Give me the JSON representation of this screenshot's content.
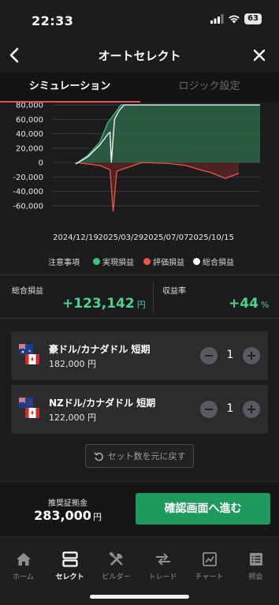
{
  "status_bar": {
    "time": "22:33",
    "battery": "63"
  },
  "nav": {
    "title": "オートセレクト"
  },
  "tabs": [
    {
      "label": "シミュレーション",
      "active": true
    },
    {
      "label": "ロジック設定",
      "active": false
    }
  ],
  "chart_data": {
    "type": "line",
    "yticks": [
      "80,000",
      "60,000",
      "40,000",
      "20,000",
      "0",
      "-20,000",
      "-40,000",
      "-60,000"
    ],
    "ylim": [
      -70000,
      80000
    ],
    "xticks": [
      "2024/12/19",
      "2025/03/29",
      "2025/07/07",
      "2025/10/15"
    ],
    "series": [
      {
        "name": "実現損益",
        "color": "#3ec27a",
        "points": [
          [
            "2024/12/19",
            -2000
          ],
          [
            "2025/01/15",
            10000
          ],
          [
            "2025/02/10",
            28000
          ],
          [
            "2025/02/28",
            55000
          ],
          [
            "2025/03/20",
            72000
          ],
          [
            "2025/03/29",
            80000
          ],
          [
            "2025/04/10",
            80000
          ]
        ]
      },
      {
        "name": "評価損益",
        "color": "#e8564a",
        "points": [
          [
            "2024/12/19",
            0
          ],
          [
            "2025/01/15",
            -2000
          ],
          [
            "2025/02/10",
            -4000
          ],
          [
            "2025/03/05",
            -10000
          ],
          [
            "2025/03/12",
            -68000
          ],
          [
            "2025/03/20",
            -12000
          ],
          [
            "2025/05/15",
            0
          ],
          [
            "2025/07/07",
            -1000
          ],
          [
            "2025/08/20",
            -4000
          ],
          [
            "2025/09/20",
            -10000
          ],
          [
            "2025/10/15",
            -14000
          ],
          [
            "2025/11/15",
            -22000
          ],
          [
            "2025/12/15",
            -15000
          ]
        ]
      },
      {
        "name": "総合損益",
        "color": "#ffffff",
        "points": [
          [
            "2024/12/19",
            -2000
          ],
          [
            "2025/01/15",
            8000
          ],
          [
            "2025/02/10",
            24000
          ],
          [
            "2025/03/01",
            40000
          ],
          [
            "2025/03/05",
            42000
          ],
          [
            "2025/03/08",
            0
          ],
          [
            "2025/03/15",
            60000
          ],
          [
            "2025/03/25",
            72000
          ],
          [
            "2025/04/05",
            80000
          ]
        ]
      }
    ]
  },
  "legend": {
    "notice": "注意事項",
    "items": [
      {
        "label": "実現損益",
        "color": "#3ec27a"
      },
      {
        "label": "評価損益",
        "color": "#e8564a"
      },
      {
        "label": "総合損益",
        "color": "#ffffff"
      }
    ]
  },
  "summary": {
    "total_label": "総合損益",
    "total_value": "+123,142",
    "total_unit": "円",
    "rate_label": "収益率",
    "rate_value": "+44",
    "rate_unit": "%"
  },
  "pairs": [
    {
      "name": "豪ドル/カナダドル 短期",
      "price": "182,000 円",
      "qty": "1",
      "flag": "AUD"
    },
    {
      "name": "NZドル/カナダドル 短期",
      "price": "122,000 円",
      "qty": "1",
      "flag": "NZD"
    }
  ],
  "reset_label": "セット数を元に戻す",
  "bottom": {
    "margin_label": "推奨証拠金",
    "margin_value": "283,000",
    "margin_unit": "円",
    "confirm_label": "確認画面へ進む"
  },
  "tabbar": [
    {
      "label": "ホーム",
      "icon": "home-icon",
      "active": false
    },
    {
      "label": "セレクト",
      "icon": "select-icon",
      "active": true
    },
    {
      "label": "ビルダー",
      "icon": "builder-icon",
      "active": false
    },
    {
      "label": "トレード",
      "icon": "trade-icon",
      "active": false
    },
    {
      "label": "チャート",
      "icon": "chart-icon",
      "active": false
    },
    {
      "label": "照会",
      "icon": "inquiry-icon",
      "active": false
    }
  ],
  "colors": {
    "accent_green": "#1e9a5e",
    "profit_green": "#4fd08b",
    "loss_red": "#e8564a",
    "tab_indicator": "#e0525a"
  }
}
